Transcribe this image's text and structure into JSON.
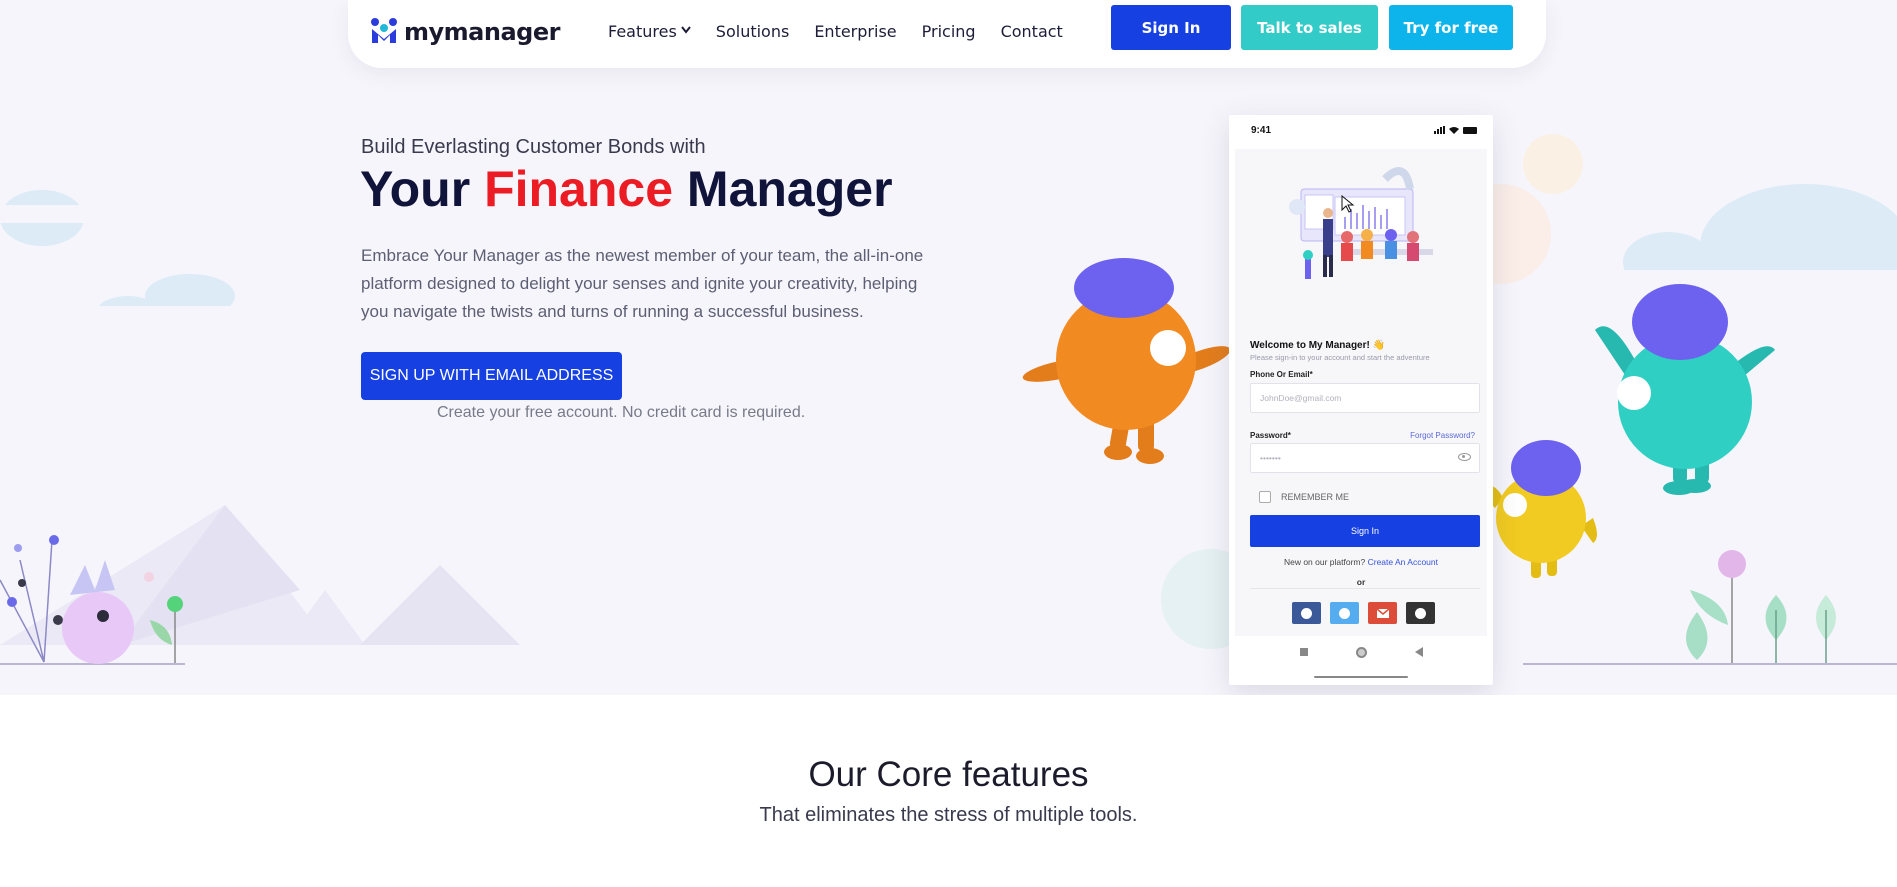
{
  "nav": {
    "logo_text": "mymanager",
    "links": [
      "Features",
      "Solutions",
      "Enterprise",
      "Pricing",
      "Contact"
    ],
    "signin_label": "Sign In",
    "sales_label": "Talk to sales",
    "try_label": "Try for free"
  },
  "hero": {
    "subheadline": "Build Everlasting Customer Bonds with",
    "headline_part1": "Your ",
    "headline_accent": "Finance",
    "headline_part2": " Manager",
    "description": "Embrace Your Manager as the newest member of your team, the all-in-one platform designed to delight your senses and ignite your creativity, helping you navigate the twists and turns of running a successful business.",
    "cta_label": "SIGN UP WITH EMAIL ADDRESS",
    "cta_note": "Create your free account. No credit card is required."
  },
  "phone": {
    "time": "9:41",
    "welcome": "Welcome to My Manager! 👋",
    "welcome_sub": "Please sign-in to your account and start the adventure",
    "email_label": "Phone Or Email*",
    "email_placeholder": "JohnDoe@gmail.com",
    "password_label": "Password*",
    "forgot_label": "Forgot Password?",
    "password_placeholder": "•••••••",
    "remember_label": "REMEMBER ME",
    "signin_label": "Sign In",
    "new_prefix": "New on our platform? ",
    "create_link": "Create An Account",
    "or_label": "or",
    "social_colors": [
      "#3b5998",
      "#55acee",
      "#dd4b39",
      "#333333"
    ]
  },
  "features": {
    "title": "Our Core features",
    "subtitle": "That eliminates the stress of multiple tools."
  },
  "colors": {
    "primary": "#1640e2",
    "teal": "#33cbc7",
    "sky": "#0db4ec",
    "accent_red": "#ec1c24",
    "navy": "#10143a"
  }
}
